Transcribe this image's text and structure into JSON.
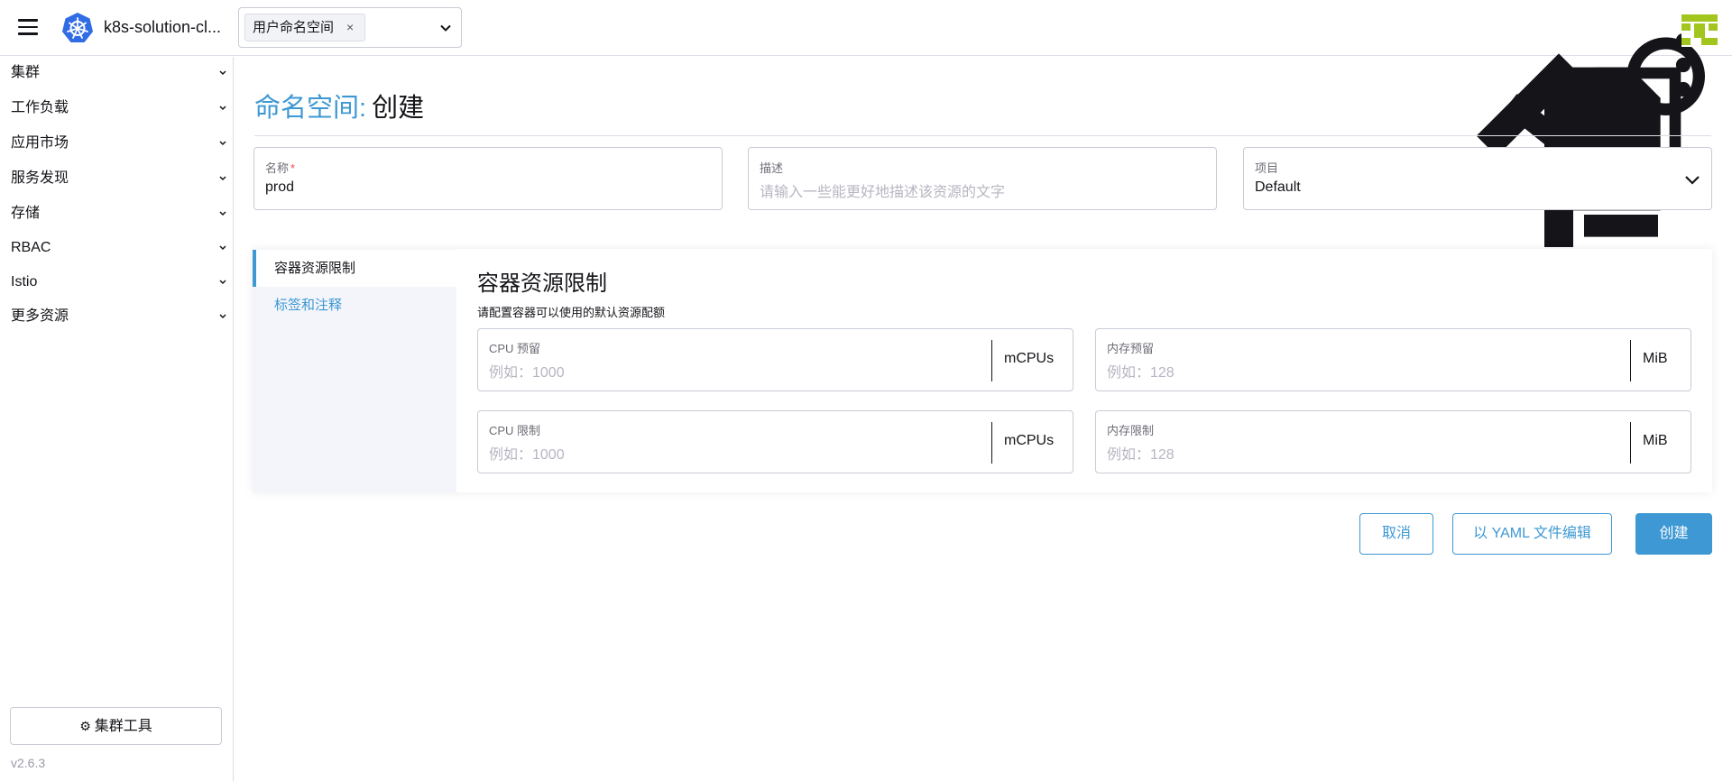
{
  "header": {
    "cluster_name": "k8s-solution-cl...",
    "namespace_tag": "用户命名空间",
    "namespace_tag_remove": "×",
    "tools": [
      "upload-icon",
      "shell-icon",
      "file-icon",
      "copy-config-icon",
      "search-icon",
      "more-vertical-icon"
    ]
  },
  "sidebar": {
    "groups": [
      {
        "label": "集群"
      },
      {
        "label": "工作负载"
      },
      {
        "label": "应用市场"
      },
      {
        "label": "服务发现"
      },
      {
        "label": "存储"
      },
      {
        "label": "RBAC"
      },
      {
        "label": "Istio"
      },
      {
        "label": "更多资源"
      }
    ],
    "cluster_tools": "集群工具",
    "version": "v2.6.3"
  },
  "page": {
    "title_type": "命名空间:",
    "title_action": "创建"
  },
  "form": {
    "name": {
      "label": "名称",
      "required_mark": "*",
      "value": "prod"
    },
    "description": {
      "label": "描述",
      "placeholder": "请输入一些能更好地描述该资源的文字"
    },
    "project": {
      "label": "项目",
      "value": "Default"
    }
  },
  "tabs": [
    {
      "label": "容器资源限制",
      "active": true
    },
    {
      "label": "标签和注释",
      "active": false
    }
  ],
  "limits": {
    "title": "容器资源限制",
    "subtitle": "请配置容器可以使用的默认资源配额",
    "cpu_reservation": {
      "label": "CPU 预留",
      "placeholder": "例如：1000",
      "unit": "mCPUs"
    },
    "memory_reservation": {
      "label": "内存预留",
      "placeholder": "例如：128",
      "unit": "MiB"
    },
    "cpu_limit": {
      "label": "CPU 限制",
      "placeholder": "例如：1000",
      "unit": "mCPUs"
    },
    "memory_limit": {
      "label": "内存限制",
      "placeholder": "例如：128",
      "unit": "MiB"
    }
  },
  "footer": {
    "cancel": "取消",
    "edit_yaml": "以 YAML 文件编辑",
    "create": "创建"
  },
  "colors": {
    "accent": "#3d98d3",
    "border": "#c9cbd5",
    "required": "#f64747",
    "avatar": "#a3c61f"
  }
}
